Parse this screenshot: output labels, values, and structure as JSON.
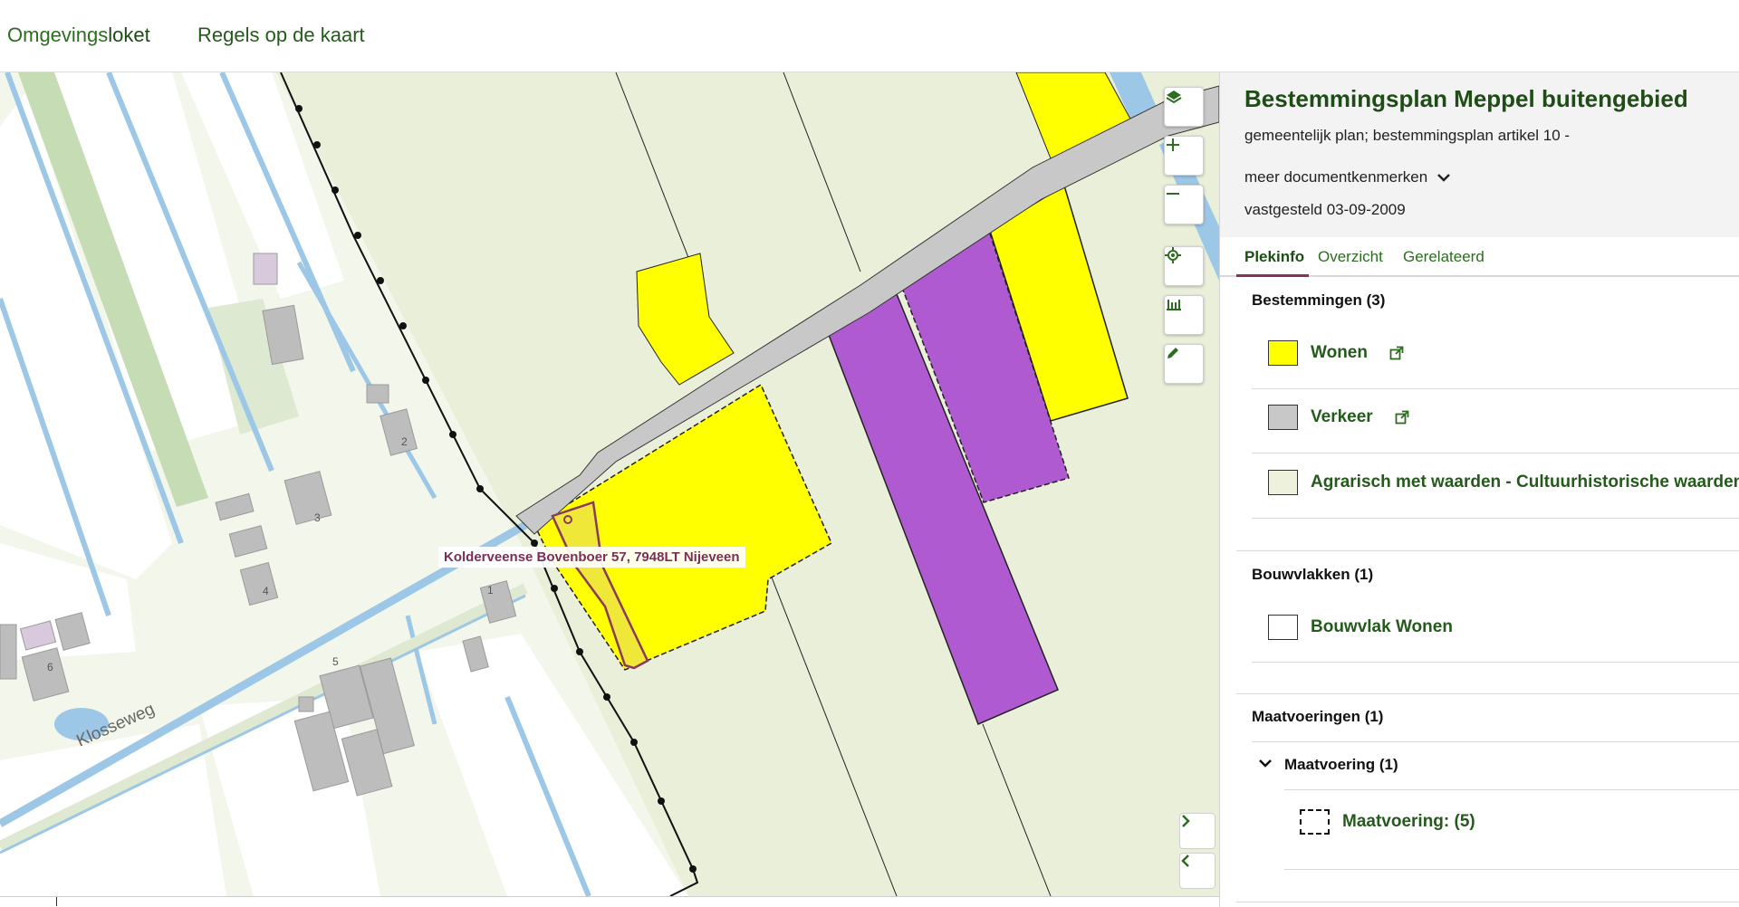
{
  "header": {
    "brand_part1": "Omgevings",
    "brand_part2": "loket",
    "nav_link": "Regels op de kaart"
  },
  "map": {
    "address_label": "Kolderveense Bovenboer 57, 7948LT Nijeveen",
    "street_label": "Klosseweg",
    "house_numbers": [
      "1",
      "2",
      "3",
      "4",
      "5",
      "6"
    ],
    "controls": [
      "layers-icon",
      "zoom-in-icon",
      "zoom-out-icon",
      "locate-icon",
      "measure-icon",
      "draw-icon"
    ],
    "colors": {
      "wonen": "#ffff00",
      "verkeer": "#c8c8c8",
      "agrarisch": "#e9efd9",
      "purple": "#b05ad2",
      "selection": "#8a3a5c"
    }
  },
  "panel": {
    "title": "Bestemmingsplan Meppel buitengebied",
    "subtitle": "gemeentelijk plan; bestemmingsplan artikel 10 -",
    "more_link": "meer documentkenmerken",
    "date": "vastgesteld 03-09-2009",
    "tabs": [
      {
        "label": "Plekinfo",
        "active": true
      },
      {
        "label": "Overzicht",
        "active": false
      },
      {
        "label": "Gerelateerd",
        "active": false
      }
    ],
    "bestemmingen": {
      "title": "Bestemmingen (3)",
      "items": [
        {
          "label": "Wonen",
          "color": "#ffff00",
          "external": true
        },
        {
          "label": "Verkeer",
          "color": "#c8c8c8",
          "external": true
        },
        {
          "label": "Agrarisch met waarden - Cultuurhistorische waarden",
          "color": "#eef2dc",
          "external": false
        }
      ]
    },
    "bouwvlakken": {
      "title": "Bouwvlakken (1)",
      "items": [
        {
          "label": "Bouwvlak Wonen",
          "color": "#ffffff"
        }
      ]
    },
    "maatvoeringen": {
      "title": "Maatvoeringen (1)",
      "group_label": "Maatvoering (1)",
      "items": [
        {
          "label": "Maatvoering: (5)"
        }
      ]
    }
  }
}
